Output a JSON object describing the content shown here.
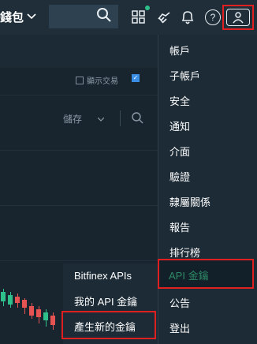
{
  "header": {
    "wallet_label": "錢包",
    "search_placeholder": ""
  },
  "toolbar": {
    "show_trades_label": "顯示交易",
    "save_label": "儲存"
  },
  "account_menu": {
    "items": [
      {
        "label": "帳戶"
      },
      {
        "label": "子帳戶"
      },
      {
        "label": "安全"
      },
      {
        "label": "通知"
      },
      {
        "label": "介面"
      },
      {
        "label": "驗證"
      },
      {
        "label": "隸屬關係"
      },
      {
        "label": "報告"
      },
      {
        "label": "排行榜"
      },
      {
        "label": "API 金鑰"
      },
      {
        "label": "公告"
      },
      {
        "label": "登出"
      }
    ]
  },
  "api_submenu": {
    "items": [
      {
        "label": "Bitfinex APIs"
      },
      {
        "label": "我的 API 金鑰"
      },
      {
        "label": "產生新的金鑰"
      }
    ]
  },
  "colors": {
    "highlight": "#e02020",
    "active_text": "#2e8a66",
    "notification_dot": "#2fbf8b"
  }
}
